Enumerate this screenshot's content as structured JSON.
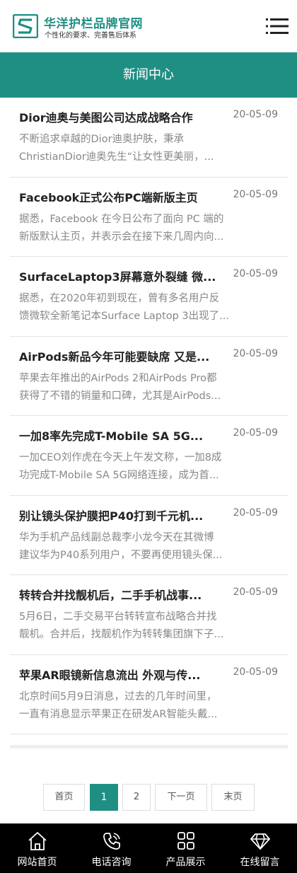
{
  "header": {
    "title": "华洋护栏品牌官网",
    "subtitle": "个性化的要求、完善售后体系",
    "logo_icon": "logo-s-icon",
    "menu_icon": "hamburger-menu-icon"
  },
  "banner": {
    "title": "新闻中心"
  },
  "news": [
    {
      "title": "Dior迪奥与美图公司达成战略合作",
      "date": "20-05-09",
      "summary_1": "不断追求卓越的Dior迪奥护肤，秉承",
      "summary_2": "ChristianDior迪奥先生“让女性更美丽，..."
    },
    {
      "title": "Facebook正式公布PC端新版主页",
      "date": "20-05-09",
      "summary_1": "据悉，Facebook 在今日公布了面向 PC 端的",
      "summary_2": "新版默认主页，并表示会在接下来几周内向..."
    },
    {
      "title": "SurfaceLaptop3屏幕意外裂缝 微...",
      "date": "20-05-09",
      "summary_1": "据悉，在2020年初到现在，曾有多名用户反",
      "summary_2": "馈微软全新笔记本Surface Laptop 3出现了..."
    },
    {
      "title": "AirPods新品今年可能要缺席 又是...",
      "date": "20-05-09",
      "summary_1": "苹果去年推出的AirPods 2和AirPods Pro都",
      "summary_2": "获得了不错的销量和口碑，尤其是AirPods..."
    },
    {
      "title": "一加8率先完成T-Mobile SA 5G...",
      "date": "20-05-09",
      "summary_1": "一加CEO刘作虎在今天上午发文称，一加8成",
      "summary_2": "功完成T-Mobile SA 5G网络连接，成为首..."
    },
    {
      "title": "别让镜头保护膜把P40打到千元机...",
      "date": "20-05-09",
      "summary_1": "华为手机产品线副总裁李小龙今天在其微博",
      "summary_2": "建议华为P40系列用户，不要再使用镜头保..."
    },
    {
      "title": "转转合并找靓机后，二手手机战事...",
      "date": "20-05-09",
      "summary_1": "5月6日，二手交易平台转转宣布战略合并找",
      "summary_2": "靓机。合并后，找靓机作为转转集团旗下子..."
    },
    {
      "title": "苹果AR眼镜新信息流出 外观与传...",
      "date": "20-05-09",
      "summary_1": "北京时间5月9日消息，过去的几年时间里，",
      "summary_2": "一直有消息显示苹果正在研发AR智能头戴..."
    }
  ],
  "pagination": {
    "first": "首页",
    "page1": "1",
    "page2": "2",
    "next": "下一页",
    "last": "末页",
    "current_page": 1
  },
  "bottom_nav": [
    {
      "label": "网站首页",
      "icon": "home-icon"
    },
    {
      "label": "电话咨询",
      "icon": "phone-icon"
    },
    {
      "label": "产品展示",
      "icon": "grid-icon"
    },
    {
      "label": "在线留言",
      "icon": "diamond-icon"
    }
  ],
  "colors": {
    "brand": "#1f8f84",
    "nav_bg": "#000000",
    "divider": "#e3e3e3"
  }
}
